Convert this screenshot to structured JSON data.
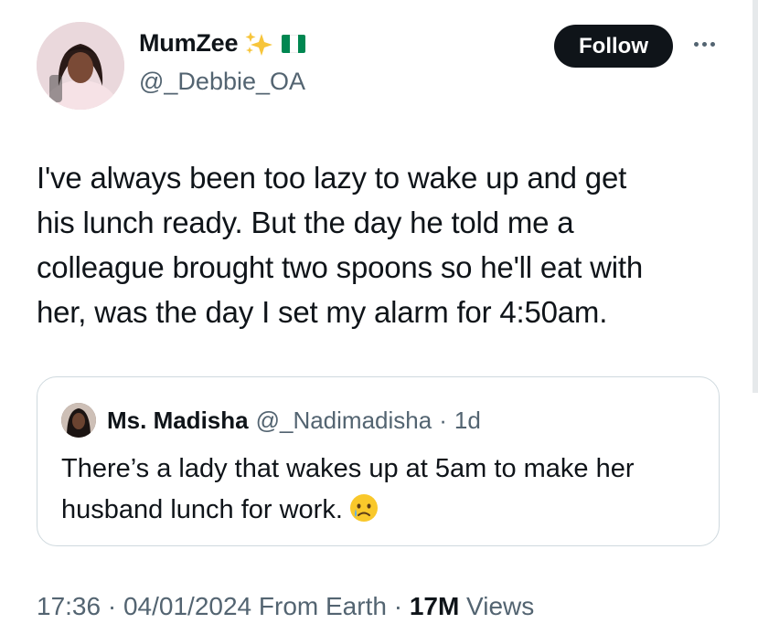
{
  "author": {
    "display_name": "MumZee",
    "handle": "@_Debbie_OA",
    "follow_label": "Follow"
  },
  "tweet": {
    "line1": "I've always been too lazy to wake up and get",
    "line2": "his lunch ready. But the day he told me a",
    "line3": "colleague brought two spoons so he'll eat with",
    "line4": "her, was the day I set my alarm for 4:50am."
  },
  "quote": {
    "name": "Ms. Madisha",
    "handle": "@_Nadimadisha",
    "separator": "·",
    "time": "1d",
    "line1": "There’s a lady that wakes up at 5am to make her",
    "line2": "husband lunch for work."
  },
  "meta": {
    "time": "17:36",
    "sep1": " · ",
    "date": "04/01/2024",
    "source": " From Earth",
    "sep2": " · ",
    "views_count": "17M",
    "views_label": " Views"
  },
  "colors": {
    "text_primary": "#0f1419",
    "text_secondary": "#536471",
    "border": "#cfd9de",
    "flag_green": "#008751"
  },
  "icons": {
    "sparkles": "sparkles-icon",
    "flag": "nigeria-flag-icon",
    "more": "more-icon",
    "emoji": "crying-face-emoji"
  }
}
